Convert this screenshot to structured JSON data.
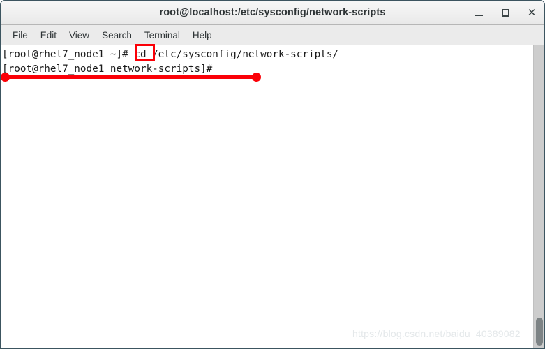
{
  "window": {
    "title": "root@localhost:/etc/sysconfig/network-scripts",
    "buttons": {
      "minimize": "minimize-icon",
      "maximize": "maximize-icon",
      "close": "close-icon"
    }
  },
  "menubar": {
    "items": [
      {
        "label": "File"
      },
      {
        "label": "Edit"
      },
      {
        "label": "View"
      },
      {
        "label": "Search"
      },
      {
        "label": "Terminal"
      },
      {
        "label": "Help"
      }
    ]
  },
  "terminal": {
    "lines": [
      {
        "prompt": "[root@rhel7_node1 ~]# ",
        "highlight": "cd",
        "rest": " /etc/sysconfig/network-scripts/"
      },
      {
        "prompt": "[root@rhel7_node1 network-scripts]#",
        "highlight": "",
        "rest": ""
      }
    ],
    "line1_full": "[root@rhel7_node1 ~]# cd /etc/sysconfig/network-scripts/",
    "line2_full": "[root@rhel7_node1 network-scripts]#"
  },
  "annotations": {
    "highlight_box_target": "cd",
    "underline_color": "#fb0007",
    "box_color": "#fb0007"
  },
  "watermark": {
    "text": "https://blog.csdn.net/baidu_40389082"
  },
  "colors": {
    "window_border": "#3c5560",
    "titlebar_bg": "#efefef",
    "menubar_bg": "#ebebeb",
    "terminal_bg": "#ffffff",
    "terminal_fg": "#1b1b1b",
    "scrollbar_track": "#cdcdcd",
    "scrollbar_thumb": "#7d8385",
    "annotation_red": "#fb0007"
  }
}
